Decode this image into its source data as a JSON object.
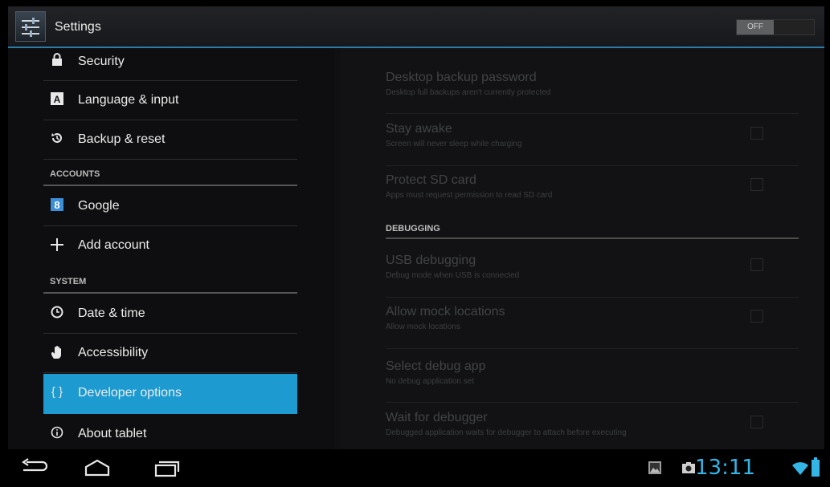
{
  "app": {
    "title": "Settings",
    "master_toggle": "OFF"
  },
  "left_panel": {
    "items_top": [
      {
        "icon": "lock-icon",
        "glyph": "🔒",
        "label": "Security"
      },
      {
        "icon": "language-icon",
        "glyph": "A",
        "label": "Language & input"
      },
      {
        "icon": "backup-icon",
        "glyph": "⟲",
        "label": "Backup & reset"
      }
    ],
    "accounts_header": "ACCOUNTS",
    "accounts": [
      {
        "icon": "google-icon",
        "glyph": "8",
        "label": "Google"
      },
      {
        "icon": "add-icon",
        "glyph": "+",
        "label": "Add account"
      }
    ],
    "system_header": "SYSTEM",
    "system": [
      {
        "icon": "clock-icon",
        "glyph": "◷",
        "label": "Date & time"
      },
      {
        "icon": "hand-icon",
        "glyph": "✋",
        "label": "Accessibility"
      },
      {
        "icon": "braces-icon",
        "glyph": "{ }",
        "label": "Developer options",
        "active": true
      },
      {
        "icon": "info-icon",
        "glyph": "ⓘ",
        "label": "About tablet"
      }
    ]
  },
  "right_panel": {
    "items": [
      {
        "title": "Desktop backup password",
        "subtitle": "Desktop full backups aren't currently protected",
        "checkbox": false
      },
      {
        "title": "Stay awake",
        "subtitle": "Screen will never sleep while charging",
        "checkbox": true,
        "checked": false
      },
      {
        "title": "Protect SD card",
        "subtitle": "Apps must request permission to read SD card",
        "checkbox": true,
        "checked": false
      }
    ],
    "debugging_header": "DEBUGGING",
    "debug_items": [
      {
        "title": "USB debugging",
        "subtitle": "Debug mode when USB is connected",
        "checkbox": true,
        "checked": false
      },
      {
        "title": "Allow mock locations",
        "subtitle": "Allow mock locations",
        "checkbox": true,
        "checked": false
      },
      {
        "title": "Select debug app",
        "subtitle": "No debug application set",
        "checkbox": false
      },
      {
        "title": "Wait for debugger",
        "subtitle": "Debugged application waits for debugger to attach before executing",
        "checkbox": true,
        "checked": false
      }
    ]
  },
  "navbar": {
    "buttons": [
      "back-icon",
      "home-icon",
      "recents-icon"
    ],
    "status_icons": [
      "gallery-notification-icon",
      "camera-notification-icon",
      "wifi-icon",
      "battery-icon"
    ],
    "time": "13:11"
  },
  "colors": {
    "accent": "#33b5e5",
    "selected": "#1d9ad0"
  }
}
